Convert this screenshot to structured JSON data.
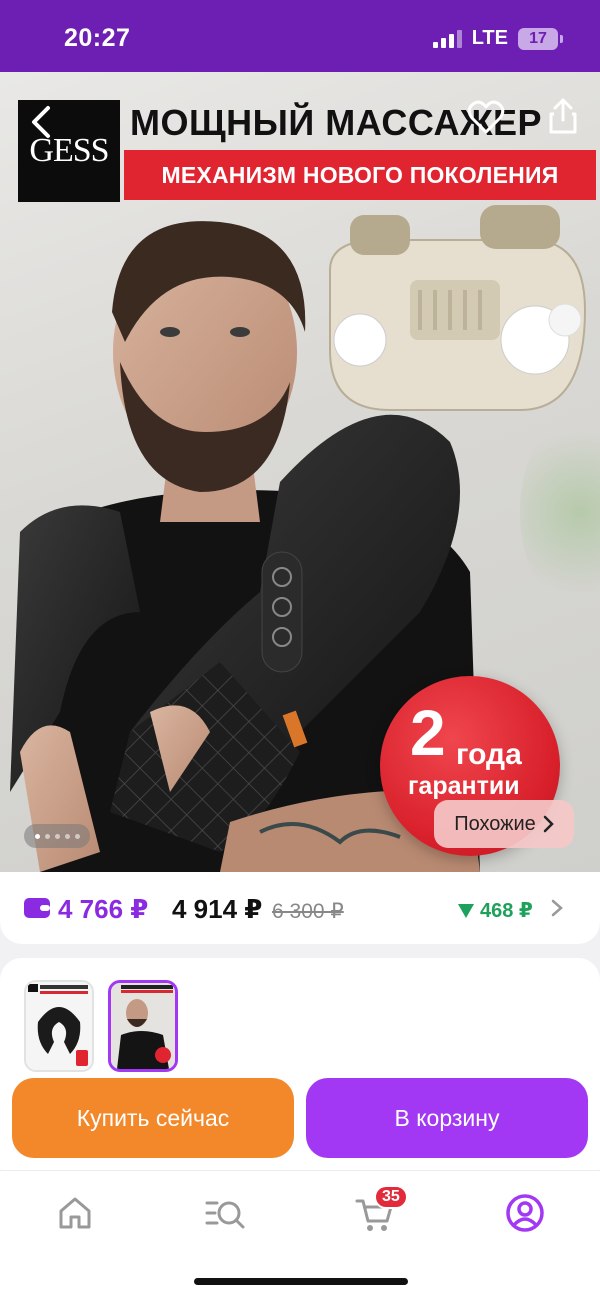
{
  "status_bar": {
    "time": "20:27",
    "network": "LTE",
    "battery": "17"
  },
  "product_image": {
    "brand_logo_text": "GESS",
    "headline": "МОЩНЫЙ МАССАЖЕР",
    "subheadline": "МЕХАНИЗМ НОВОГО ПОКОЛЕНИЯ",
    "warranty_number": "2",
    "warranty_word": "года",
    "warranty_sub": "гарантии",
    "similar_label": "Похожие",
    "carousel_total": 5,
    "carousel_active": 1,
    "icons": [
      "back-arrow-icon",
      "heart-icon",
      "share-icon"
    ]
  },
  "price": {
    "wallet_price": "4 766 ₽",
    "price": "4 914 ₽",
    "old_price": "6 300 ₽",
    "discount": "468 ₽",
    "colors": {
      "wallet": "#8a2be2",
      "discount": "#1ea15a"
    }
  },
  "variants": {
    "items": [
      "variant-1",
      "variant-2"
    ],
    "selected_index": 1
  },
  "actions": {
    "buy_now": "Купить сейчас",
    "add_to_cart": "В корзину",
    "colors": {
      "buy_now": "#f3882a",
      "add_to_cart": "#a238f3"
    }
  },
  "bottom_nav": {
    "items": [
      "home-icon",
      "catalog-search-icon",
      "cart-icon",
      "profile-icon"
    ],
    "cart_count": "35",
    "active": "profile-icon"
  }
}
